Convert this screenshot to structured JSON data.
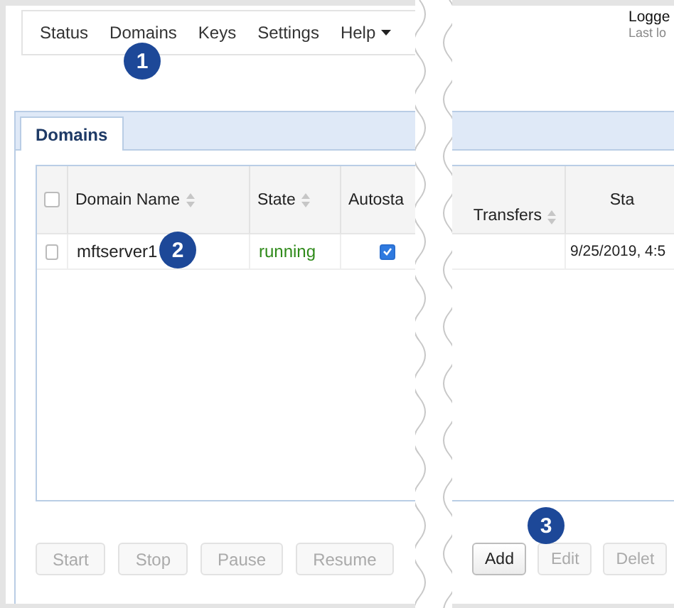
{
  "nav": {
    "items": [
      {
        "label": "Status",
        "kind": "link"
      },
      {
        "label": "Domains",
        "kind": "link"
      },
      {
        "label": "Keys",
        "kind": "link"
      },
      {
        "label": "Settings",
        "kind": "link"
      },
      {
        "label": "Help",
        "kind": "menu"
      }
    ]
  },
  "user": {
    "logged_in": "Logge",
    "last_login": "Last lo"
  },
  "tabs": [
    {
      "label": "Domains",
      "selected": true
    }
  ],
  "left_table": {
    "select_all": {
      "checked": false
    },
    "columns": [
      {
        "label": "Domain Name",
        "sortable": true
      },
      {
        "label": "State",
        "sortable": true
      },
      {
        "label": "Autosta",
        "sortable": false
      }
    ],
    "rows": [
      {
        "checked": false,
        "domain": "mftserver1",
        "state": "running",
        "autostart": true
      }
    ]
  },
  "right_table": {
    "columns": [
      {
        "label": "Transfers",
        "sortable": true
      },
      {
        "label": "Sta",
        "sortable": false
      }
    ],
    "rows": [
      {
        "column_2": "9/25/2019, 4:5"
      }
    ]
  },
  "left_buttons": [
    {
      "label": "Start",
      "disabled": true
    },
    {
      "label": "Stop",
      "disabled": true
    },
    {
      "label": "Pause",
      "disabled": true
    },
    {
      "label": "Resume",
      "disabled": true
    }
  ],
  "right_buttons": [
    {
      "label": "Add",
      "disabled": false
    },
    {
      "label": "Edit",
      "disabled": true
    },
    {
      "label": "Delet",
      "disabled": true
    }
  ],
  "callouts": [
    {
      "number": "1"
    },
    {
      "number": "2"
    },
    {
      "number": "3"
    }
  ]
}
